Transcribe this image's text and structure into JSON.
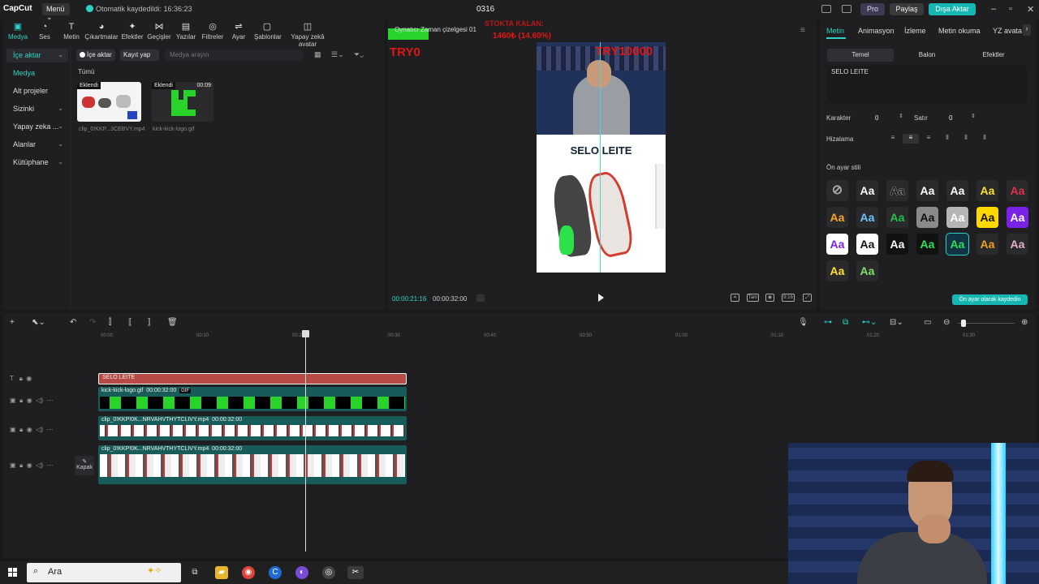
{
  "titlebar": {
    "logo": "CapCut",
    "menu": "Menü ⌄",
    "autosave": "Otomatik kaydedildi: 16:36:23",
    "project": "0316",
    "pro": "Pro",
    "share": "Paylaş",
    "export": "Dışa Aktar"
  },
  "toolbar": [
    {
      "label": "Medya",
      "icon": "▣"
    },
    {
      "label": "Ses",
      "icon": "◔"
    },
    {
      "label": "Metin",
      "icon": "T"
    },
    {
      "label": "Çıkartmalar",
      "icon": "◕"
    },
    {
      "label": "Efektler",
      "icon": "✦"
    },
    {
      "label": "Geçişler",
      "icon": "⋈"
    },
    {
      "label": "Yazılar",
      "icon": "▤"
    },
    {
      "label": "Filtreler",
      "icon": "◎"
    },
    {
      "label": "Ayar",
      "icon": "⇌"
    },
    {
      "label": "Şablonlar",
      "icon": "▢"
    },
    {
      "label": "Yapay zekâ avatar",
      "icon": "◫"
    }
  ],
  "sidenav": [
    {
      "label": "İçe aktar",
      "chev": "⌄"
    },
    {
      "label": "Medya",
      "chev": ""
    },
    {
      "label": "Alt projeler",
      "chev": ""
    },
    {
      "label": "Sizinki",
      "chev": "⌄"
    },
    {
      "label": "Yapay zeka ...",
      "chev": "⌄"
    },
    {
      "label": "Alanlar",
      "chev": "⌄"
    },
    {
      "label": "Kütüphane",
      "chev": "⌄"
    }
  ],
  "media": {
    "import_btn": "İçe aktar",
    "record_btn": "Kayıt yap",
    "search_placeholder": "Medya arayın",
    "filter_all": "Tümü",
    "items": [
      {
        "badge": "Eklendi",
        "duration": "",
        "name": "clip_0!KKP...3CEBVY.mp4"
      },
      {
        "badge": "Eklendi",
        "duration": "00:09",
        "name": "kick-kick-logo.gif"
      }
    ]
  },
  "player": {
    "header": "Oynatıcı Zaman çizelgesi 01",
    "red_top": "STOKTA KALAN:",
    "red_percent": "1460₺ (14.60%)",
    "try_left": "TRY0",
    "try_right": "TRY10000",
    "overlay_text": "SELO LEITE",
    "time_current": "00:00:21:16",
    "time_total": "00:00:32:00",
    "btn_full": "Tam",
    "btn_ratio": "9:16"
  },
  "right": {
    "tabs": [
      "Metin",
      "Animasyon",
      "İzleme",
      "Metin okuma",
      "YZ avata"
    ],
    "subtabs": [
      "Temel",
      "Balon",
      "Efektler"
    ],
    "text_value": "SELO LEITE",
    "karakter_label": "Karakter",
    "karakter_value": "0",
    "satir_label": "Satır",
    "satir_value": "0",
    "hizalama_label": "Hizalama",
    "preset_label": "Ön ayar stili",
    "preset_glyph": "Aa",
    "save_preset": "Ön ayar olarak kaydedin",
    "preset_colors": [
      {
        "bg": "#2a2a2c",
        "fg": "#fff",
        "none": true
      },
      {
        "bg": "#2a2a2c",
        "fg": "#fff"
      },
      {
        "bg": "#2a2a2c",
        "fg": "#111",
        "stroke": "#fff"
      },
      {
        "bg": "#2a2a2c",
        "fg": "#fff"
      },
      {
        "bg": "#2a2a2c",
        "fg": "#fff"
      },
      {
        "bg": "#2a2a2c",
        "fg": "#ffe033"
      },
      {
        "bg": "#2a2a2c",
        "fg": "#e0314a"
      },
      {
        "bg": "#2a2a2c",
        "fg": "#f5a623"
      },
      {
        "bg": "#2a2a2c",
        "fg": "#6cc4ff"
      },
      {
        "bg": "#2a2a2c",
        "fg": "#21c14a"
      },
      {
        "bg": "#8a8a8a",
        "fg": "#111"
      },
      {
        "bg": "#b5b5b5",
        "fg": "#fff"
      },
      {
        "bg": "#ffd800",
        "fg": "#111"
      },
      {
        "bg": "#7b22e8",
        "fg": "#fff"
      },
      {
        "bg": "#fff",
        "fg": "#7b22e8"
      },
      {
        "bg": "#fff",
        "fg": "#111"
      },
      {
        "bg": "#111",
        "fg": "#fff"
      },
      {
        "bg": "#111",
        "fg": "#2ee05a"
      },
      {
        "bg": "#134",
        "fg": "#2ee05a"
      },
      {
        "bg": "#2a2a2c",
        "fg": "#f0a020"
      },
      {
        "bg": "#2a2a2c",
        "fg": "#e5b0c8"
      },
      {
        "bg": "#2a2a2c",
        "fg": "#ffe033"
      },
      {
        "bg": "#2a2a2c",
        "fg": "#7ee068"
      }
    ]
  },
  "timeline": {
    "ruler": [
      "00:00",
      "00:10",
      "00:20",
      "00:30",
      "00:40",
      "00:50",
      "01:00",
      "01:10",
      "01:20",
      "01:30"
    ],
    "cover_label": "Kapak",
    "text_clip": "SELO LEITE",
    "gif_clip": "kick-kick-logo.gif",
    "gif_duration": "00:00:32:00",
    "gif_badge": "GIF",
    "video1": "clip_0!KKP!0K...NRVAHVTHYTCLIVY.mp4",
    "video1_duration": "00:00:32:00",
    "video2": "clip_0!KKP!0K...NRVAHVTHYTCLIVY.mp4",
    "video2_duration": "00:00:32:00"
  },
  "taskbar": {
    "search": "Ara"
  },
  "colors": {
    "accent": "#2bd3c6",
    "kick_green": "#28d42a",
    "text_clip": "#b74a44",
    "video_clip": "#175c58",
    "alert_red": "#e01515"
  }
}
